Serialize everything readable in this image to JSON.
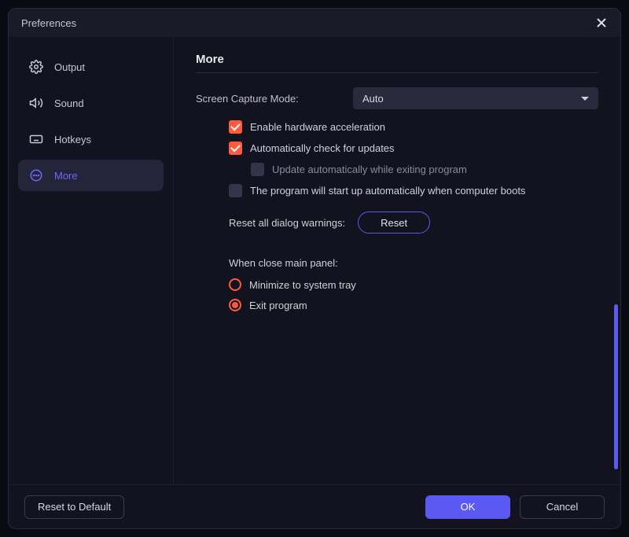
{
  "titlebar": {
    "title": "Preferences"
  },
  "sidebar": {
    "items": [
      {
        "label": "Output"
      },
      {
        "label": "Sound"
      },
      {
        "label": "Hotkeys"
      },
      {
        "label": "More"
      }
    ]
  },
  "section": {
    "title": "More"
  },
  "capture_mode": {
    "label": "Screen Capture Mode:",
    "value": "Auto"
  },
  "checks": {
    "hw_accel": "Enable hardware acceleration",
    "auto_update": "Automatically check for updates",
    "update_on_exit": "Update automatically while exiting program",
    "start_on_boot": "The program will start up automatically when computer boots"
  },
  "reset_warnings": {
    "label": "Reset all dialog warnings:",
    "button": "Reset"
  },
  "close_panel": {
    "heading": "When close main panel:",
    "minimize": "Minimize to system tray",
    "exit": "Exit program"
  },
  "footer": {
    "reset_default": "Reset to Default",
    "ok": "OK",
    "cancel": "Cancel"
  }
}
